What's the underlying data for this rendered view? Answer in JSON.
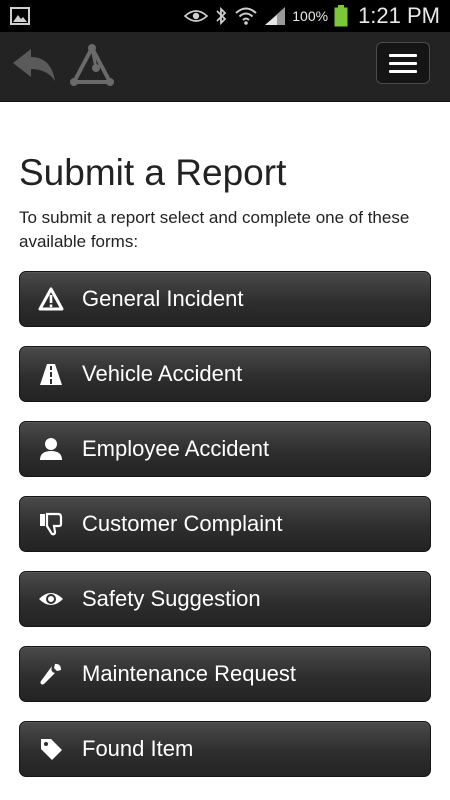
{
  "status_bar": {
    "battery_percent": "100%",
    "time": "1:21 PM",
    "icons": [
      "picture-icon",
      "eye-icon",
      "bluetooth-icon",
      "wifi-icon",
      "signal-icon",
      "battery-icon"
    ]
  },
  "header": {
    "back_icon": "back-arrow-icon",
    "logo_icon": "triangle-logo-icon",
    "menu_icon": "hamburger-menu-icon"
  },
  "page": {
    "title": "Submit a Report",
    "intro": "To submit a report select and complete one of these available forms:"
  },
  "forms": [
    {
      "label": "General Incident",
      "icon": "warning-icon"
    },
    {
      "label": "Vehicle Accident",
      "icon": "road-icon"
    },
    {
      "label": "Employee Accident",
      "icon": "person-icon"
    },
    {
      "label": "Customer Complaint",
      "icon": "thumbs-down-icon"
    },
    {
      "label": "Safety Suggestion",
      "icon": "eye-icon"
    },
    {
      "label": "Maintenance Request",
      "icon": "wrench-icon"
    },
    {
      "label": "Found Item",
      "icon": "tag-icon"
    }
  ],
  "colors": {
    "status_bar_bg": "#000000",
    "header_bg": "#232323",
    "button_bg": "#2e2e2e",
    "button_text": "#ffffff",
    "battery_green": "#7cc63a"
  }
}
